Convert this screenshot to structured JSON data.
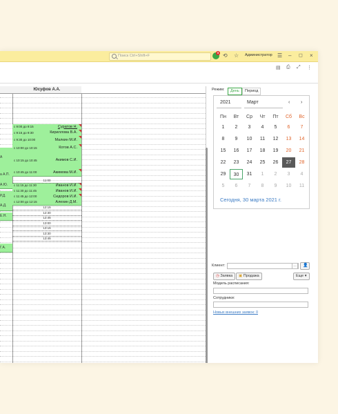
{
  "titlebar": {
    "search_placeholder": "Поиск Ctrl+Shift+F",
    "notifications_count": "5",
    "user_name": "Администратор"
  },
  "schedule": {
    "employee_header": "Юсуфов А.А.",
    "left_fragments": [
      "А",
      "а А.П.",
      "А.Ю.",
      "Р.Д.",
      "А.Д.",
      "Е.Н.",
      "Г.А."
    ],
    "appointments": [
      {
        "time": "с 9:00 до 9:15",
        "name": "Суратов Н."
      },
      {
        "time": "с 9:15 до 9:30",
        "name": "Кириллова В.А."
      },
      {
        "time": "с 9:30 до 10:00",
        "name": "Малкин М.И."
      },
      {
        "time": "с 10:00 до 10:15",
        "name": "Котов А.С."
      },
      {
        "time": "с 10:15 до 10:45",
        "name": "Акимов С.И."
      },
      {
        "time": "с 10:45 до 11:00",
        "name": "Акимова М.И."
      },
      {
        "time": "с 11:15 до 11:30",
        "name": "Иванов И.И."
      },
      {
        "time": "с 11:30 до 11:45",
        "name": "Иванов И.И."
      },
      {
        "time": "с 11:45 до 12:00",
        "name": "Сидоров И.И."
      },
      {
        "time": "с 12:00 до 12:15",
        "name": "Алехин Д.М."
      }
    ],
    "gap_label": "11:00",
    "free_slots": [
      "12:15",
      "12:30",
      "12:45",
      "13:00",
      "13:15",
      "13:30",
      "13:45"
    ]
  },
  "panel": {
    "mode_label": "Режим:",
    "tab_day": "День",
    "tab_period": "Период",
    "calendar": {
      "year": "2021",
      "month": "Март",
      "weekdays": [
        "Пн",
        "Вт",
        "Ср",
        "Чт",
        "Пт",
        "Сб",
        "Вс"
      ],
      "weeks": [
        [
          "1",
          "2",
          "3",
          "4",
          "5",
          "6",
          "7"
        ],
        [
          "8",
          "9",
          "10",
          "11",
          "12",
          "13",
          "14"
        ],
        [
          "15",
          "16",
          "17",
          "18",
          "19",
          "20",
          "21"
        ],
        [
          "22",
          "23",
          "24",
          "25",
          "26",
          "27",
          "28"
        ],
        [
          "29",
          "30",
          "31",
          "1",
          "2",
          "3",
          "4"
        ],
        [
          "5",
          "6",
          "7",
          "8",
          "9",
          "10",
          "11"
        ]
      ],
      "today_link": "Сегодня, 30 марта 2021 г."
    },
    "client_label": "Клиент:",
    "btn_request": "Заявка",
    "btn_sale": "Продажа",
    "btn_more": "Еще",
    "model_label": "Модель расписания:",
    "staff_label": "Сотрудники:",
    "new_request_link": "Новых внешних заявок: 0"
  },
  "colors": {
    "titlebar": "#fbed9e",
    "appointment": "#9ef09b",
    "weekend": "#e0642a",
    "link": "#3b7bc4"
  }
}
